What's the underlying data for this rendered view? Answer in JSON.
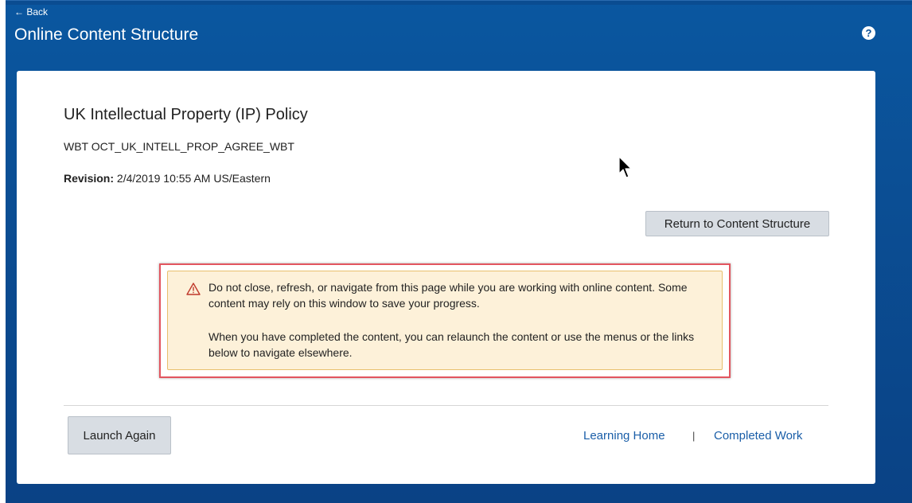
{
  "header": {
    "back_label": "← Back",
    "title": "Online Content Structure",
    "help_icon": "help-icon",
    "help_glyph": "?"
  },
  "content": {
    "title": "UK Intellectual Property (IP) Policy",
    "code": "WBT OCT_UK_INTELL_PROP_AGREE_WBT",
    "revision_label": "Revision:",
    "revision_value": "2/4/2019 10:55 AM US/Eastern"
  },
  "buttons": {
    "return_label": "Return to Content Structure",
    "launch_again_label": "Launch Again"
  },
  "warning": {
    "icon": "warning-icon",
    "line1": "Do not close, refresh, or navigate from this page while you are working with online content. Some content may rely on this window to save your progress.",
    "line2": "When you have completed the content, you can relaunch the content or use the menus or the links below to navigate elsewhere."
  },
  "footer_links": {
    "learning_home": "Learning Home",
    "separator": "|",
    "completed_work": "Completed Work"
  },
  "colors": {
    "header_blue": "#0b4f95",
    "link_blue": "#1a5ea8",
    "warning_bg": "#fdf1d9",
    "highlight_red": "#e2555f"
  }
}
